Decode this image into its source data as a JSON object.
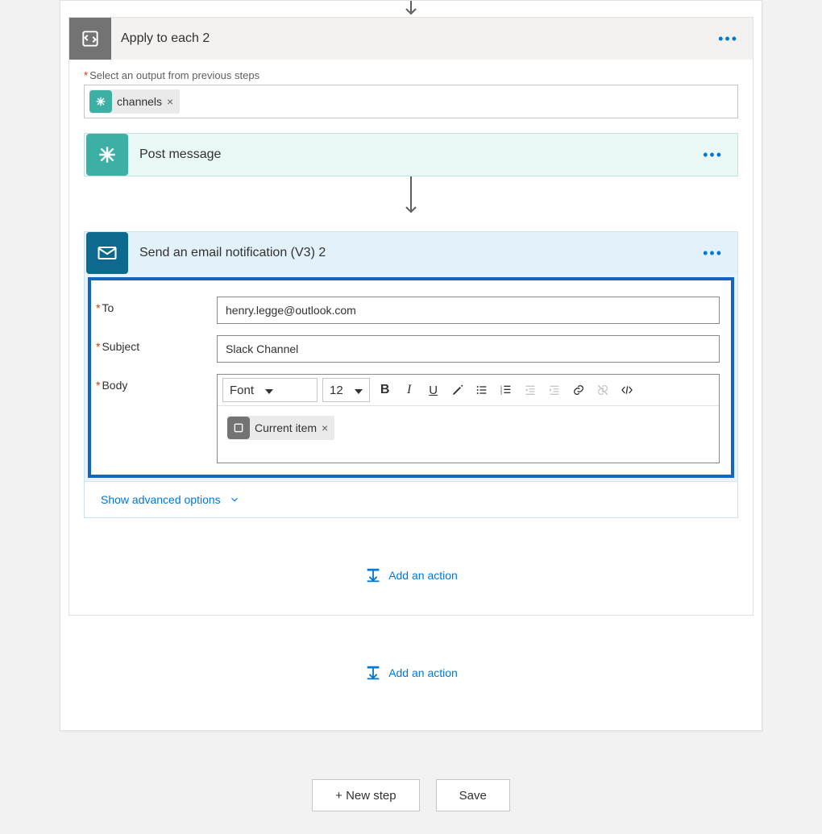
{
  "foreach": {
    "title": "Apply to each 2",
    "select_label": "Select an output from previous steps",
    "token_label": "channels"
  },
  "post_message": {
    "title": "Post message"
  },
  "email": {
    "title": "Send an email notification (V3) 2",
    "fields": {
      "to_label": "To",
      "to_value": "henry.legge@outlook.com",
      "subject_label": "Subject",
      "subject_value": "Slack Channel",
      "body_label": "Body"
    },
    "rte": {
      "font_label": "Font",
      "size_label": "12",
      "body_token": "Current item"
    },
    "advanced_label": "Show advanced options"
  },
  "add_action_label": "Add an action",
  "footer": {
    "new_step": "+ New step",
    "save": "Save"
  }
}
